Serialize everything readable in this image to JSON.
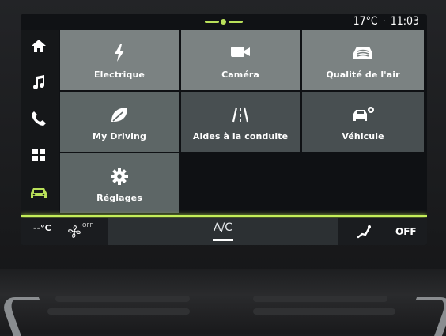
{
  "status": {
    "temperature": "17°C",
    "separator": "·",
    "time": "11:03"
  },
  "sidebar": {
    "items": [
      {
        "icon": "home-icon"
      },
      {
        "icon": "music-icon"
      },
      {
        "icon": "phone-icon"
      },
      {
        "icon": "apps-grid-icon"
      },
      {
        "icon": "car-icon",
        "active": true
      }
    ],
    "active_color": "#b9e05a"
  },
  "tiles": [
    {
      "label": "Electrique",
      "icon": "lightning-icon"
    },
    {
      "label": "Caméra",
      "icon": "video-camera-icon"
    },
    {
      "label": "Qualité de l'air",
      "icon": "air-quality-icon"
    },
    {
      "label": "My Driving",
      "icon": "leaf-icon"
    },
    {
      "label": "Aides à la conduite",
      "icon": "road-lanes-icon"
    },
    {
      "label": "Véhicule",
      "icon": "vehicle-settings-icon"
    },
    {
      "label": "Réglages",
      "icon": "gear-icon"
    }
  ],
  "climate": {
    "left_temp": "--°C",
    "fan_status": "OFF",
    "ac_label": "A/C",
    "right_status": "OFF"
  },
  "colors": {
    "accent": "#c4ef5a",
    "tile_light": "#7b8282",
    "tile_mid": "#5d6666",
    "tile_dark": "#484f51"
  }
}
